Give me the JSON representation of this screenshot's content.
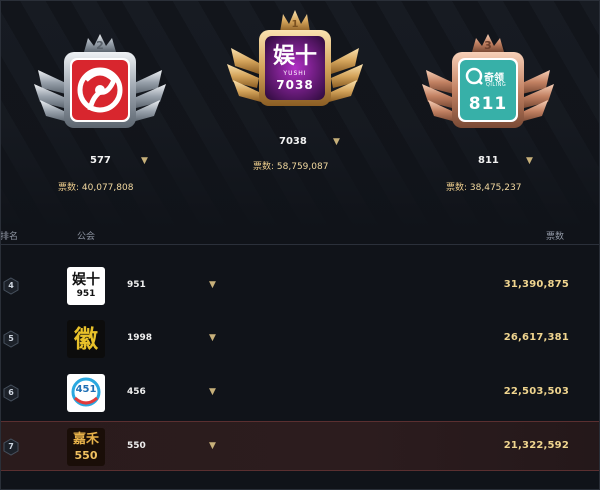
{
  "podium": [
    {
      "rank": "2",
      "name": "577",
      "votes_label": "票数:",
      "votes": "40,077,808",
      "dropdown": "▼"
    },
    {
      "rank": "1",
      "name": "7038",
      "votes_label": "票数:",
      "votes": "58,759,087",
      "dropdown": "▼",
      "logo_text": "娱十",
      "logo_sub": "YUSHI",
      "logo_num": "7038"
    },
    {
      "rank": "3",
      "name": "811",
      "votes_label": "票数:",
      "votes": "38,475,237",
      "dropdown": "▼",
      "logo_text": "奇领",
      "logo_sub": "QILING",
      "logo_num": "811"
    }
  ],
  "table": {
    "headers": {
      "rank": "排名",
      "guild": "公会",
      "votes": "票数"
    },
    "rows": [
      {
        "rank": "4",
        "name": "951",
        "votes": "31,390,875",
        "dropdown": "▼",
        "logo_text": "娱十",
        "logo_num": "951",
        "active": false
      },
      {
        "rank": "5",
        "name": "1998",
        "votes": "26,617,381",
        "dropdown": "▼",
        "logo_text": "徽",
        "active": false
      },
      {
        "rank": "6",
        "name": "456",
        "votes": "22,503,503",
        "dropdown": "▼",
        "logo_num": "451",
        "active": false
      },
      {
        "rank": "7",
        "name": "550",
        "votes": "21,322,592",
        "dropdown": "▼",
        "logo_text": "嘉禾",
        "logo_num": "550",
        "active": true
      }
    ]
  },
  "colors": {
    "background": "#101319",
    "gold_text": "#f0d58f",
    "active_row": "#2a1b1c",
    "silver": "#b9c0c8",
    "gold": "#d9a85a",
    "bronze": "#c98a6a"
  }
}
